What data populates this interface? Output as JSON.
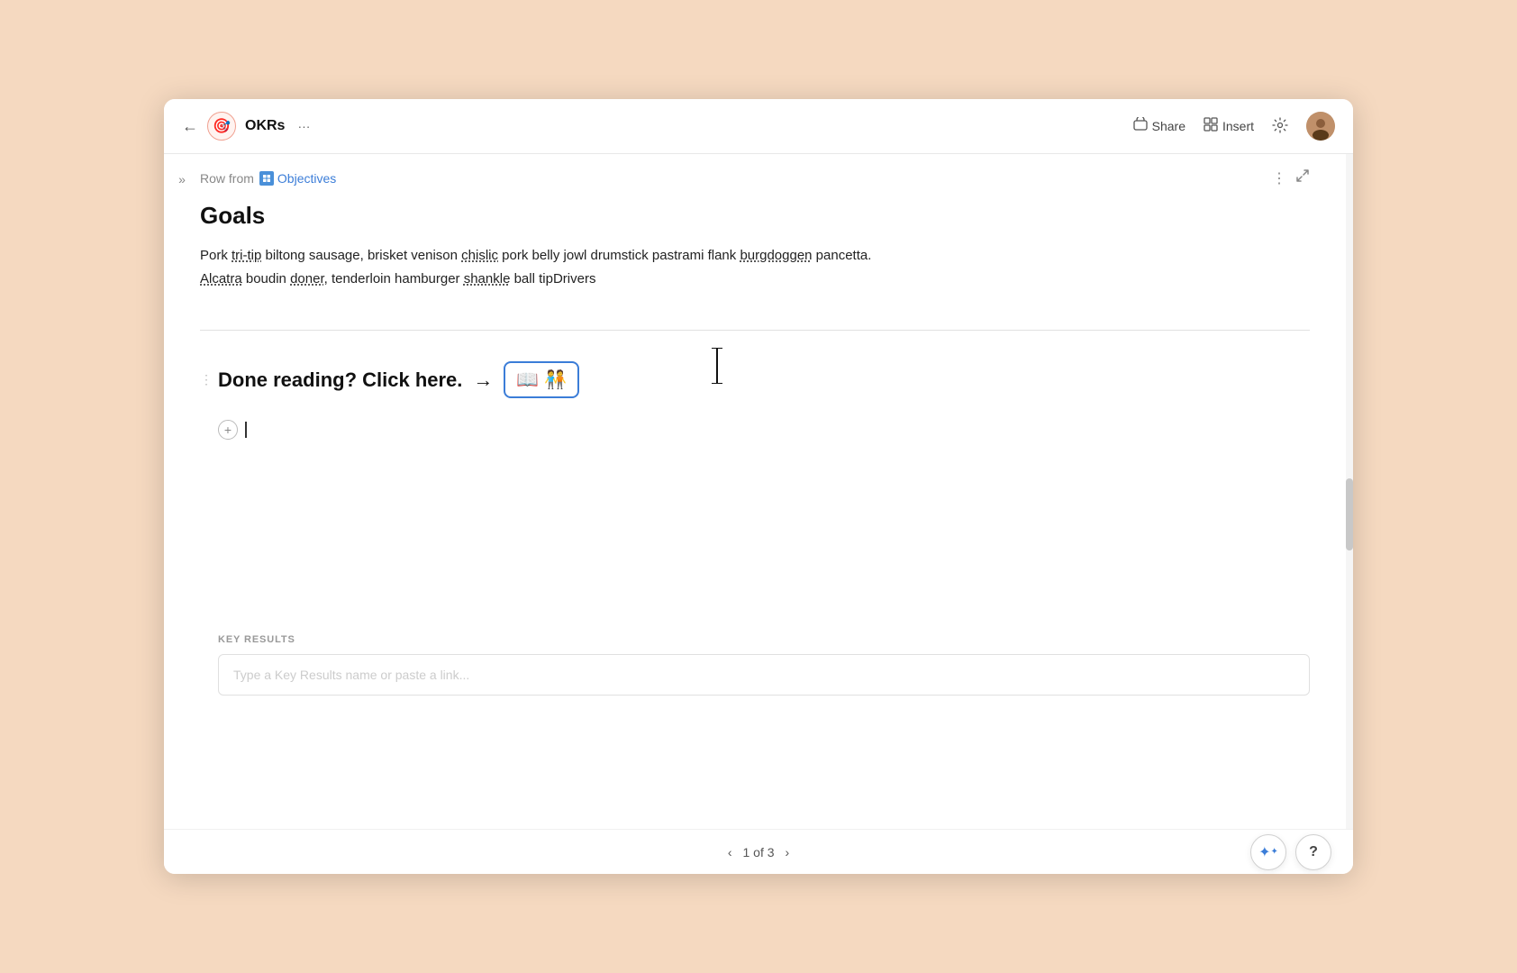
{
  "app": {
    "title": "OKRs",
    "more_label": "···",
    "back_icon": "←",
    "app_icon": "🎯"
  },
  "toolbar": {
    "share_label": "Share",
    "insert_label": "Insert",
    "share_icon": "⊞",
    "insert_icon": "⊞",
    "settings_icon": "⚙"
  },
  "breadcrumb": {
    "row_from_label": "Row from",
    "db_name": "Objectives",
    "more_icon": "⋮",
    "expand_icon": "⤢"
  },
  "document": {
    "title": "Goals",
    "body": "Pork tri-tip biltong sausage, brisket venison chislic pork belly jowl drumstick pastrami flank burgdoggen pancetta. Alcatra boudin doner, tenderloin hamburger shankle ball tipDrivers",
    "underlined_words": [
      "tri-tip",
      "chislic",
      "burgdoggen",
      "Alcatra",
      "doner",
      "shankle"
    ],
    "cta_text": "Done reading? Click here.",
    "cta_arrow": "→",
    "cta_emoji": "📖🧑‍🤝‍🧑"
  },
  "key_results": {
    "label": "KEY RESULTS",
    "placeholder": "Type a Key Results name or paste a link..."
  },
  "pagination": {
    "current": "1",
    "total": "3",
    "label": "1 of 3",
    "prev_icon": "‹",
    "next_icon": "›"
  },
  "floating_buttons": {
    "sparkle_icon": "✦",
    "help_icon": "?"
  },
  "sidebar": {
    "toggle_icon": "»"
  }
}
